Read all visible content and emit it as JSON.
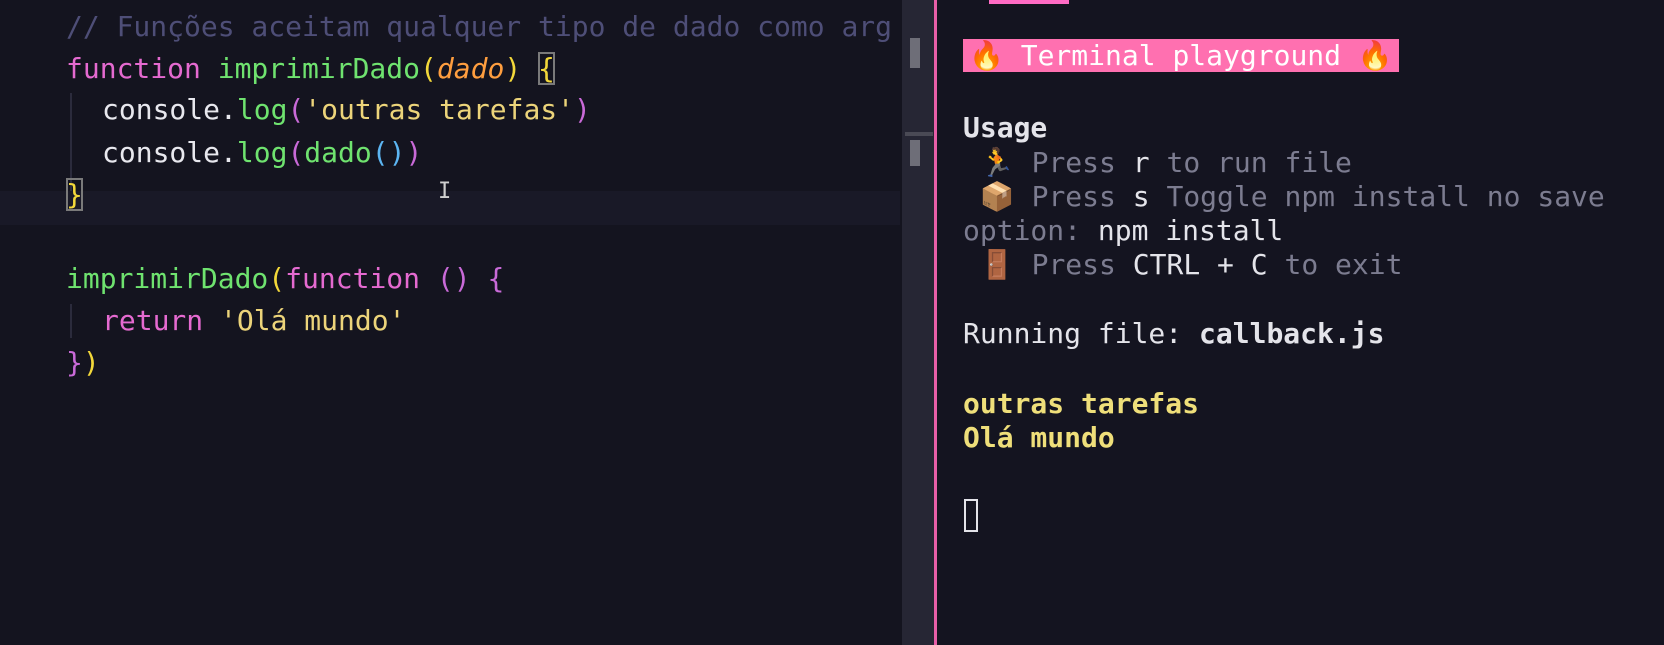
{
  "editor": {
    "comment": "// Funções aceitam qualquer tipo de dado como arg",
    "l2": {
      "kw": "function",
      "fn": "imprimirDado",
      "open": "(",
      "param": "dado",
      "close": ")",
      "brace": "{"
    },
    "l3": {
      "obj": "console.",
      "method": "log",
      "open": "(",
      "str": "'outras tarefas'",
      "close": ")"
    },
    "l4": {
      "obj": "console.",
      "method": "log",
      "open": "(",
      "call": "dado",
      "inner": "()",
      "close": ")"
    },
    "l5": {
      "brace": "}"
    },
    "l7": {
      "fn": "imprimirDado",
      "open": "(",
      "kw": "function",
      "parens": "()",
      "brace": "{"
    },
    "l8": {
      "kw": "return",
      "str": "'Olá mundo'"
    },
    "l9": {
      "brace": "}",
      "close": ")"
    }
  },
  "terminal": {
    "banner": "🔥 Terminal playground 🔥",
    "usage_title": "Usage",
    "usage": [
      {
        "icon": "🏃",
        "pre": "Press ",
        "key": "r",
        "post": " to run file"
      },
      {
        "icon": "📦",
        "pre": "Press ",
        "key": "s",
        "post": " Toggle npm install no save"
      },
      {
        "cont_label": "option: ",
        "cont_value": "npm install"
      },
      {
        "icon": "🚪",
        "pre": "Press ",
        "key": "CTRL + C",
        "post": " to exit"
      }
    ],
    "running_label": "Running file: ",
    "running_file": "callback.js",
    "output": [
      "outras tarefas",
      "Olá mundo"
    ]
  },
  "colors": {
    "accent": "#e85ea8",
    "banner_bg": "#ff70b0",
    "keyword": "#e56ad0",
    "function": "#6fe36f",
    "string": "#ecd47a",
    "comment": "#4e4e77"
  }
}
